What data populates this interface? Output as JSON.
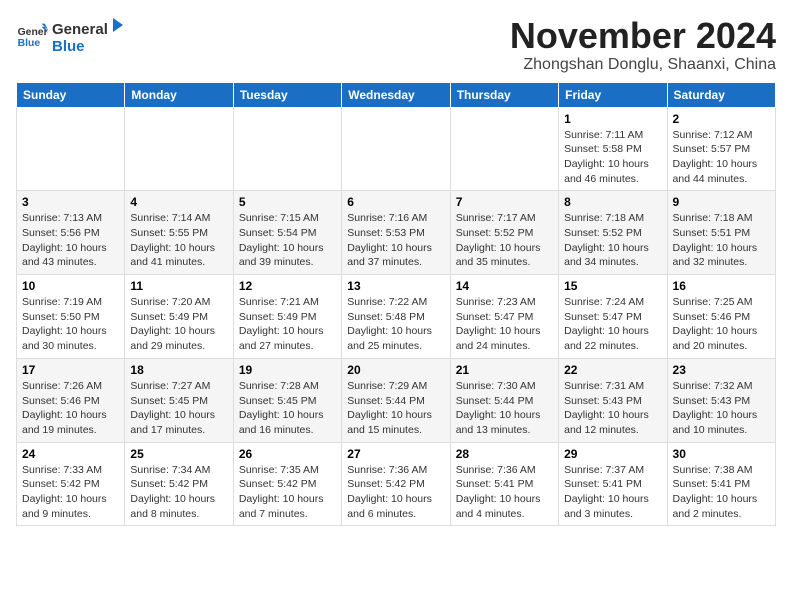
{
  "header": {
    "logo_general": "General",
    "logo_blue": "Blue",
    "month": "November 2024",
    "location": "Zhongshan Donglu, Shaanxi, China"
  },
  "weekdays": [
    "Sunday",
    "Monday",
    "Tuesday",
    "Wednesday",
    "Thursday",
    "Friday",
    "Saturday"
  ],
  "weeks": [
    [
      {
        "day": "",
        "info": ""
      },
      {
        "day": "",
        "info": ""
      },
      {
        "day": "",
        "info": ""
      },
      {
        "day": "",
        "info": ""
      },
      {
        "day": "",
        "info": ""
      },
      {
        "day": "1",
        "info": "Sunrise: 7:11 AM\nSunset: 5:58 PM\nDaylight: 10 hours and 46 minutes."
      },
      {
        "day": "2",
        "info": "Sunrise: 7:12 AM\nSunset: 5:57 PM\nDaylight: 10 hours and 44 minutes."
      }
    ],
    [
      {
        "day": "3",
        "info": "Sunrise: 7:13 AM\nSunset: 5:56 PM\nDaylight: 10 hours and 43 minutes."
      },
      {
        "day": "4",
        "info": "Sunrise: 7:14 AM\nSunset: 5:55 PM\nDaylight: 10 hours and 41 minutes."
      },
      {
        "day": "5",
        "info": "Sunrise: 7:15 AM\nSunset: 5:54 PM\nDaylight: 10 hours and 39 minutes."
      },
      {
        "day": "6",
        "info": "Sunrise: 7:16 AM\nSunset: 5:53 PM\nDaylight: 10 hours and 37 minutes."
      },
      {
        "day": "7",
        "info": "Sunrise: 7:17 AM\nSunset: 5:52 PM\nDaylight: 10 hours and 35 minutes."
      },
      {
        "day": "8",
        "info": "Sunrise: 7:18 AM\nSunset: 5:52 PM\nDaylight: 10 hours and 34 minutes."
      },
      {
        "day": "9",
        "info": "Sunrise: 7:18 AM\nSunset: 5:51 PM\nDaylight: 10 hours and 32 minutes."
      }
    ],
    [
      {
        "day": "10",
        "info": "Sunrise: 7:19 AM\nSunset: 5:50 PM\nDaylight: 10 hours and 30 minutes."
      },
      {
        "day": "11",
        "info": "Sunrise: 7:20 AM\nSunset: 5:49 PM\nDaylight: 10 hours and 29 minutes."
      },
      {
        "day": "12",
        "info": "Sunrise: 7:21 AM\nSunset: 5:49 PM\nDaylight: 10 hours and 27 minutes."
      },
      {
        "day": "13",
        "info": "Sunrise: 7:22 AM\nSunset: 5:48 PM\nDaylight: 10 hours and 25 minutes."
      },
      {
        "day": "14",
        "info": "Sunrise: 7:23 AM\nSunset: 5:47 PM\nDaylight: 10 hours and 24 minutes."
      },
      {
        "day": "15",
        "info": "Sunrise: 7:24 AM\nSunset: 5:47 PM\nDaylight: 10 hours and 22 minutes."
      },
      {
        "day": "16",
        "info": "Sunrise: 7:25 AM\nSunset: 5:46 PM\nDaylight: 10 hours and 20 minutes."
      }
    ],
    [
      {
        "day": "17",
        "info": "Sunrise: 7:26 AM\nSunset: 5:46 PM\nDaylight: 10 hours and 19 minutes."
      },
      {
        "day": "18",
        "info": "Sunrise: 7:27 AM\nSunset: 5:45 PM\nDaylight: 10 hours and 17 minutes."
      },
      {
        "day": "19",
        "info": "Sunrise: 7:28 AM\nSunset: 5:45 PM\nDaylight: 10 hours and 16 minutes."
      },
      {
        "day": "20",
        "info": "Sunrise: 7:29 AM\nSunset: 5:44 PM\nDaylight: 10 hours and 15 minutes."
      },
      {
        "day": "21",
        "info": "Sunrise: 7:30 AM\nSunset: 5:44 PM\nDaylight: 10 hours and 13 minutes."
      },
      {
        "day": "22",
        "info": "Sunrise: 7:31 AM\nSunset: 5:43 PM\nDaylight: 10 hours and 12 minutes."
      },
      {
        "day": "23",
        "info": "Sunrise: 7:32 AM\nSunset: 5:43 PM\nDaylight: 10 hours and 10 minutes."
      }
    ],
    [
      {
        "day": "24",
        "info": "Sunrise: 7:33 AM\nSunset: 5:42 PM\nDaylight: 10 hours and 9 minutes."
      },
      {
        "day": "25",
        "info": "Sunrise: 7:34 AM\nSunset: 5:42 PM\nDaylight: 10 hours and 8 minutes."
      },
      {
        "day": "26",
        "info": "Sunrise: 7:35 AM\nSunset: 5:42 PM\nDaylight: 10 hours and 7 minutes."
      },
      {
        "day": "27",
        "info": "Sunrise: 7:36 AM\nSunset: 5:42 PM\nDaylight: 10 hours and 6 minutes."
      },
      {
        "day": "28",
        "info": "Sunrise: 7:36 AM\nSunset: 5:41 PM\nDaylight: 10 hours and 4 minutes."
      },
      {
        "day": "29",
        "info": "Sunrise: 7:37 AM\nSunset: 5:41 PM\nDaylight: 10 hours and 3 minutes."
      },
      {
        "day": "30",
        "info": "Sunrise: 7:38 AM\nSunset: 5:41 PM\nDaylight: 10 hours and 2 minutes."
      }
    ]
  ]
}
